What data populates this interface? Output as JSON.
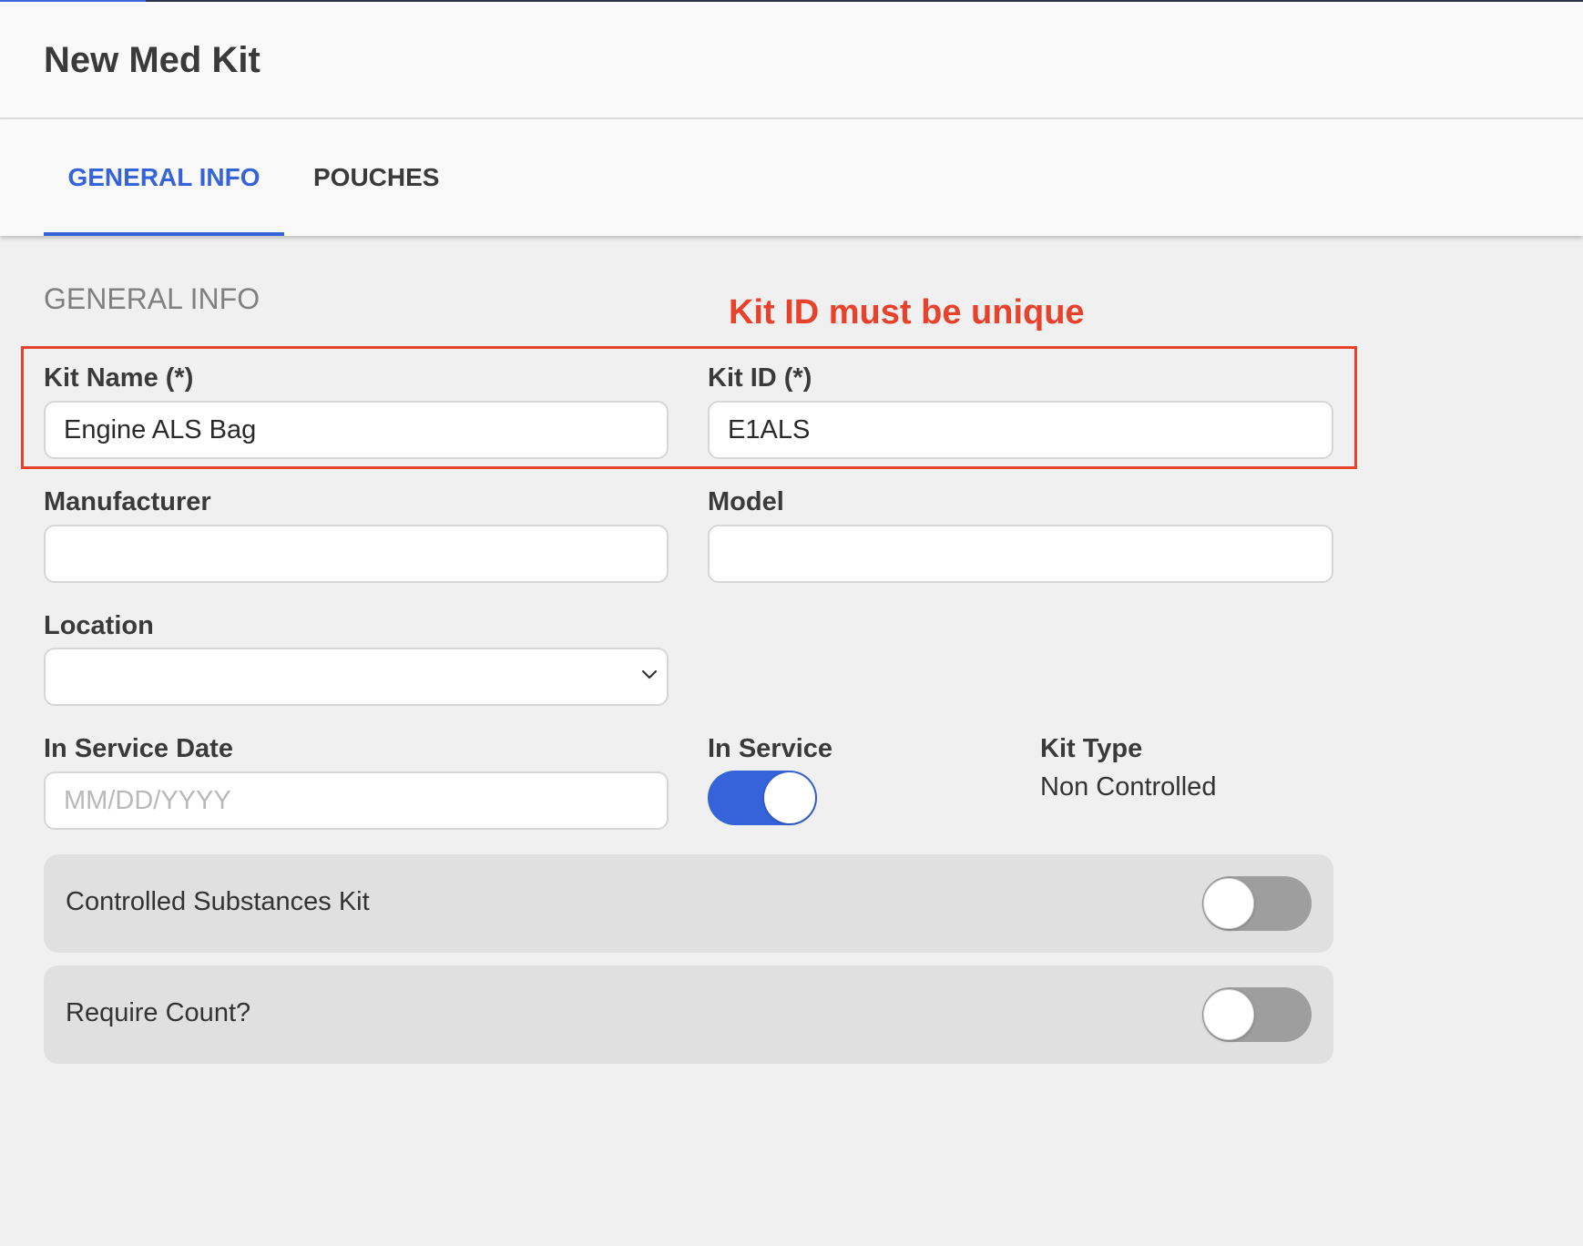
{
  "page": {
    "title": "New Med Kit"
  },
  "tabs": [
    {
      "label": "GENERAL INFO",
      "active": true
    },
    {
      "label": "POUCHES",
      "active": false
    }
  ],
  "form": {
    "section_title": "GENERAL INFO",
    "annotation": "Kit ID must be unique",
    "annotation_color": "#e8412c",
    "kit_name": {
      "label": "Kit Name (*)",
      "value": "Engine ALS Bag"
    },
    "kit_id": {
      "label": "Kit ID (*)",
      "value": "E1ALS"
    },
    "manufacturer": {
      "label": "Manufacturer",
      "value": ""
    },
    "model": {
      "label": "Model",
      "value": ""
    },
    "location": {
      "label": "Location",
      "value": ""
    },
    "in_service_date": {
      "label": "In Service Date",
      "value": "",
      "placeholder": "MM/DD/YYYY"
    },
    "in_service": {
      "label": "In Service",
      "on": true
    },
    "kit_type": {
      "label": "Kit Type",
      "value": "Non Controlled"
    },
    "controlled_substances": {
      "label": "Controlled Substances Kit",
      "on": false
    },
    "require_count": {
      "label": "Require Count?",
      "on": false
    }
  },
  "colors": {
    "accent": "#3563d9",
    "toggle_off": "#9e9e9e",
    "background": "#f0f0f0"
  }
}
